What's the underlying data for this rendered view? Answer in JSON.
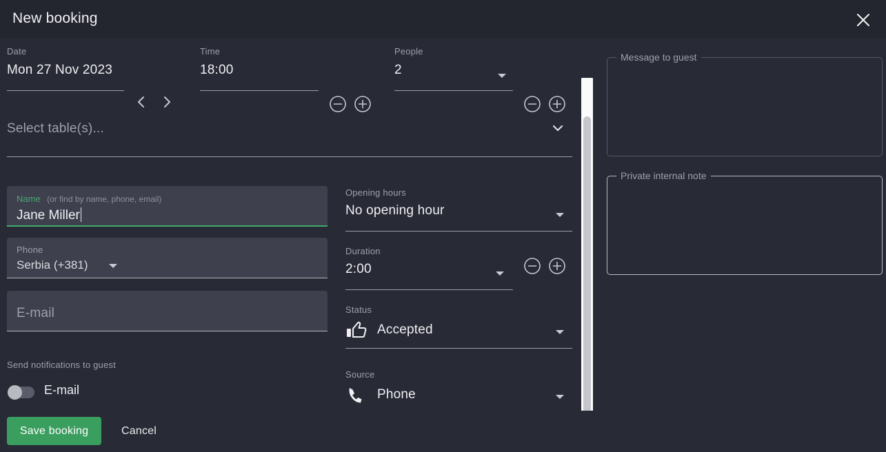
{
  "header": {
    "title": "New booking",
    "close_icon": "close-icon"
  },
  "date": {
    "label": "Date",
    "value": "Mon 27 Nov 2023",
    "prev_icon": "chevron-left-icon",
    "next_icon": "chevron-right-icon"
  },
  "time": {
    "label": "Time",
    "value": "18:00",
    "decrement_icon": "minus-circle-icon",
    "increment_icon": "plus-circle-icon"
  },
  "people": {
    "label": "People",
    "value": "2",
    "dropdown_icon": "caret-down-icon",
    "decrement_icon": "minus-circle-icon",
    "increment_icon": "plus-circle-icon"
  },
  "tables": {
    "placeholder": "Select table(s)...",
    "dropdown_icon": "chevron-down-icon"
  },
  "name": {
    "label": "Name",
    "hint": "(or find by name, phone, email)",
    "value": "Jane Miller"
  },
  "phone": {
    "label": "Phone",
    "country": "Serbia (+381)",
    "dropdown_icon": "caret-down-icon"
  },
  "email": {
    "placeholder": "E-mail"
  },
  "opening_hours": {
    "label": "Opening hours",
    "value": "No opening hour",
    "dropdown_icon": "caret-down-icon"
  },
  "duration": {
    "label": "Duration",
    "value": "2:00",
    "dropdown_icon": "caret-down-icon",
    "decrement_icon": "minus-circle-icon",
    "increment_icon": "plus-circle-icon"
  },
  "status": {
    "label": "Status",
    "value": "Accepted",
    "icon": "thumbs-up-icon",
    "dropdown_icon": "caret-down-icon"
  },
  "source": {
    "label": "Source",
    "value": "Phone",
    "icon": "phone-icon",
    "dropdown_icon": "caret-down-icon"
  },
  "message_to_guest": {
    "legend": "Message to guest",
    "value": ""
  },
  "private_note": {
    "legend": "Private internal note",
    "value": ""
  },
  "notifications": {
    "heading": "Send notifications to guest",
    "email_label": "E-mail",
    "email_enabled": false
  },
  "footer": {
    "save_label": "Save booking",
    "cancel_label": "Cancel"
  },
  "colors": {
    "accent_green": "#3a9e5f",
    "focus_green": "#3fa96a",
    "dialog_bg": "#282a36",
    "header_bg": "#24262f",
    "field_bg": "#3e404e"
  }
}
